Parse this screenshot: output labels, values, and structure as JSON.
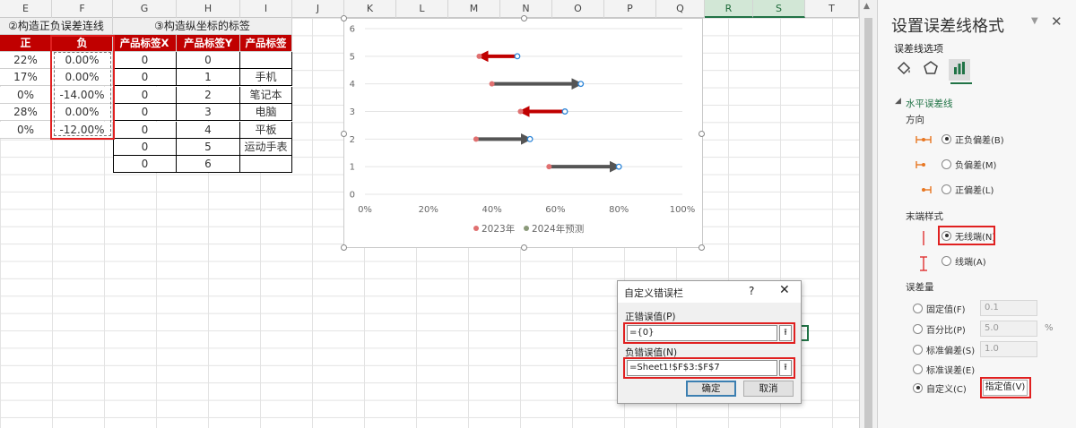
{
  "sheet": {
    "columns": [
      "E",
      "F",
      "G",
      "H",
      "I",
      "J",
      "K",
      "L",
      "M",
      "N",
      "O",
      "P",
      "Q",
      "R",
      "S",
      "T"
    ],
    "selected_columns": [
      "R",
      "S"
    ],
    "group1_title": "②构造正负误差连线",
    "group2_title": "③构造纵坐标的标签",
    "headers": [
      "正",
      "负",
      "产品标签X",
      "产品标签Y",
      "产品标签"
    ],
    "rows": [
      [
        "22%",
        "0.00%",
        "0",
        "0",
        ""
      ],
      [
        "17%",
        "0.00%",
        "0",
        "1",
        "手机"
      ],
      [
        "0%",
        "-14.00%",
        "0",
        "2",
        "笔记本"
      ],
      [
        "28%",
        "0.00%",
        "0",
        "3",
        "电脑"
      ],
      [
        "0%",
        "-12.00%",
        "0",
        "4",
        "平板"
      ],
      [
        "",
        "",
        "0",
        "5",
        "运动手表"
      ],
      [
        "",
        "",
        "0",
        "6",
        ""
      ]
    ]
  },
  "chart_data": {
    "type": "scatter",
    "x_ticks": [
      "0%",
      "20%",
      "40%",
      "60%",
      "80%",
      "100%"
    ],
    "y_ticks": [
      "0",
      "1",
      "2",
      "3",
      "4",
      "5",
      "6"
    ],
    "xlim": [
      0,
      1
    ],
    "ylim": [
      0,
      6
    ],
    "series": [
      {
        "name": "2023年",
        "color": "#e07070",
        "points": [
          [
            0.58,
            1
          ],
          [
            0.35,
            2
          ],
          [
            0.49,
            3
          ],
          [
            0.4,
            4
          ],
          [
            0.36,
            5
          ]
        ]
      },
      {
        "name": "2024年预测",
        "color": "#8b9a7a",
        "points": [
          [
            0.8,
            1
          ],
          [
            0.52,
            2
          ],
          [
            0.63,
            3
          ],
          [
            0.68,
            4
          ],
          [
            0.48,
            5
          ]
        ]
      }
    ],
    "arrows": [
      {
        "y": 1,
        "from": 0.58,
        "to": 0.8,
        "color": "#555555"
      },
      {
        "y": 2,
        "from": 0.35,
        "to": 0.52,
        "color": "#555555"
      },
      {
        "y": 3,
        "from": 0.63,
        "to": 0.49,
        "color": "#c00000"
      },
      {
        "y": 4,
        "from": 0.4,
        "to": 0.68,
        "color": "#555555"
      },
      {
        "y": 5,
        "from": 0.48,
        "to": 0.36,
        "color": "#c00000"
      }
    ],
    "legend": [
      "2023年",
      "2024年预测"
    ],
    "legend_position": "bottom",
    "grid": "horizontal"
  },
  "dialog": {
    "title": "自定义错误栏",
    "help": "?",
    "close": "✕",
    "pos_label": "正错误值(P)",
    "pos_value": "={0}",
    "neg_label": "负错误值(N)",
    "neg_value": "=Sheet1!$F$3:$F$7",
    "ok": "确定",
    "cancel": "取消"
  },
  "pane": {
    "title": "设置误差线格式",
    "subtitle": "误差线选项",
    "section": "水平误差线",
    "direction_label": "方向",
    "direction_options": [
      "正负偏差(B)",
      "负偏差(M)",
      "正偏差(L)"
    ],
    "endstyle_label": "末端样式",
    "endstyle_options": [
      "无线端(N)",
      "线端(A)"
    ],
    "amount_label": "误差量",
    "amount_options": [
      "固定值(F)",
      "百分比(P)",
      "标准偏差(S)",
      "标准误差(E)",
      "自定义(C)"
    ],
    "fixed_value": "0.1",
    "percent_value": "5.0",
    "percent_unit": "%",
    "stddev_value": "1.0",
    "specify_button": "指定值(V)"
  }
}
